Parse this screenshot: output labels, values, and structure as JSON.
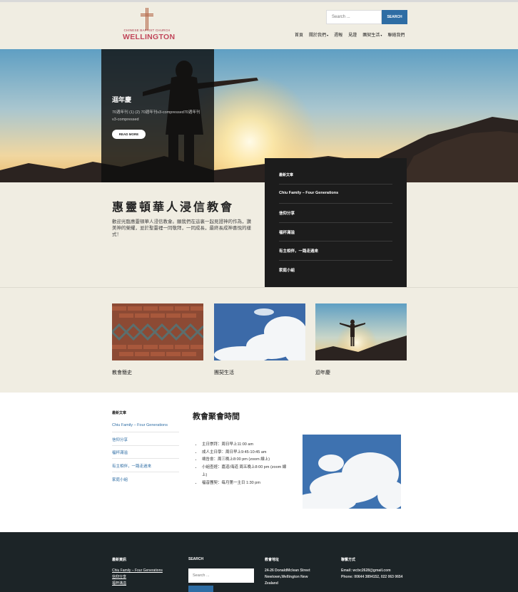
{
  "header": {
    "logo_small": "CHINESE BAPTIST CHURCH",
    "logo_big": "WELLINGTON",
    "search_placeholder": "Search ...",
    "search_button": "SEARCH",
    "nav": [
      "首頁",
      "關於我們",
      "週報",
      "見證",
      "團契生活",
      "聯絡我們"
    ]
  },
  "hero": {
    "title": "迴年慶",
    "text": "70週年刊 (1) (2) 70週年刊v3-compressed70週年刊v3-compressed",
    "button": "READ MORE"
  },
  "recent": {
    "heading": "最新文章",
    "items": [
      "Chiu Family – Four Generations",
      "信仰分享",
      "福杯滿溢",
      "有主相伴，一路走過來",
      "家庭小組"
    ]
  },
  "church": {
    "title": "惠靈頓華人浸信教會",
    "desc": "歡迎光臨惠靈頓華人浸信教會。願我們在這裏一起見證神的作為，讚美神的榮耀，並於聖靈裡一同敬拜，一同成長，最終長成神喜悅的樣式！"
  },
  "panels": [
    "教會簡史",
    "團契生活",
    "迴年慶"
  ],
  "sidebar": {
    "heading": "最新文章",
    "items": [
      "Chiu Family – Four Generations",
      "信仰分享",
      "福杯滿溢",
      "有主相伴，一路走過來",
      "家庭小組"
    ]
  },
  "services": {
    "title": "教會聚會時間",
    "items": [
      "主日崇拜：周日早上11:00 am",
      "成人主日學：周日早上9:45-10:45 am",
      "禱告會：周三晚上8:00 pm (zoom 線上)",
      "小組查經：嘉道/海道 周五晚上8:00 pm (zoom 線上)",
      "福音團契：每月第一主日 1:30 pm"
    ]
  },
  "footer": {
    "col1_head": "最新資訊",
    "col1_items": [
      "Chiu Family – Four Generations",
      "信仰分享",
      "福杯滿溢"
    ],
    "col2_head": "SEARCH",
    "col2_placeholder": "Search ...",
    "col3_head": "教會地址",
    "col3_text": "24-26 DonaldMclean Street Newtown,Wellington New Zealand",
    "col4_head": "聯繫方式",
    "col4_email": "Email: wcbc2628@gmail.com",
    "col4_phone": "Phone: 00644 3894152, 022 063 0654"
  },
  "colors": {
    "accent": "#2e6da4",
    "logo": "#c1465a",
    "footer_bg": "#1c2427"
  }
}
